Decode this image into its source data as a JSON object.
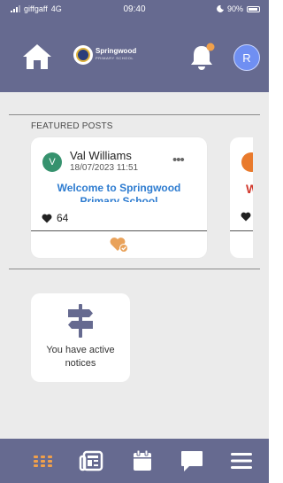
{
  "status_bar": {
    "carrier": "giffgaff",
    "network": "4G",
    "time": "09:40",
    "battery": "90%"
  },
  "header": {
    "logo_name": "Springwood",
    "logo_subtitle": "PRIMARY SCHOOL",
    "avatar_initial": "R",
    "notification_dot_color": "#f0a04b"
  },
  "featured": {
    "section_title": "FEATURED POSTS",
    "posts": [
      {
        "avatar_initial": "V",
        "author": "Val Williams",
        "date": "18/07/2023 11:51",
        "title": "Welcome to Springwood Primary School",
        "likes": "64"
      },
      {
        "title_partial": "W"
      }
    ]
  },
  "notice_card": {
    "text": "You have active notices",
    "icon": "signpost-icon"
  },
  "bottom_nav": {
    "items": [
      "dashboard-icon",
      "news-icon",
      "calendar-icon",
      "messages-icon",
      "menu-icon"
    ],
    "active_color": "#f0a04b"
  }
}
